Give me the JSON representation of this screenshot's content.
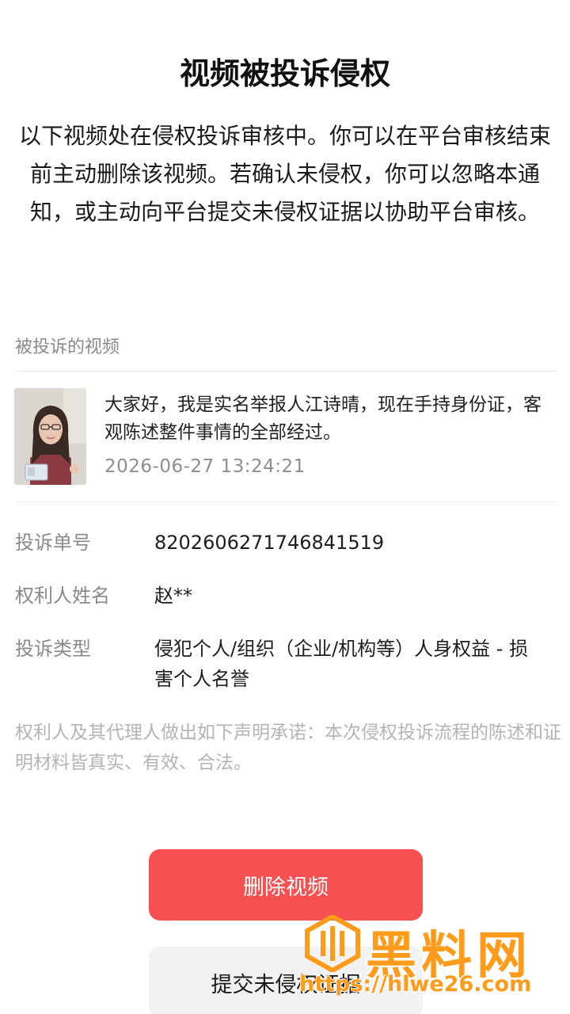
{
  "page": {
    "title": "视频被投诉侵权",
    "description": "以下视频处在侵权投诉审核中。你可以在平台审核结束前主动删除该视频。若确认未侵权，你可以忽略本通知，或主动向平台提交未侵权证据以协助平台审核。"
  },
  "video_section": {
    "label": "被投诉的视频",
    "caption": "大家好，我是实名举报人江诗晴，现在手持身份证，客观陈述整件事情的全部经过。",
    "timestamp": "2026-06-27 13:24:21"
  },
  "details": [
    {
      "key": "投诉单号",
      "value": "8202606271746841519"
    },
    {
      "key": "权利人姓名",
      "value": "赵**"
    },
    {
      "key": "投诉类型",
      "value": "侵犯个人/组织（企业/机构等）人身权益 - 损害个人名誉"
    }
  ],
  "statement": "权利人及其代理人做出如下声明承诺：本次侵权投诉流程的陈述和证明材料皆真实、有效、合法。",
  "buttons": {
    "delete": "删除视频",
    "submit": "提交未侵权证据"
  },
  "watermark": {
    "title": "黑料网",
    "url": "https://hlwe26.com"
  },
  "colors": {
    "delete_button": "#f75050",
    "watermark": "#ff9b1a"
  }
}
